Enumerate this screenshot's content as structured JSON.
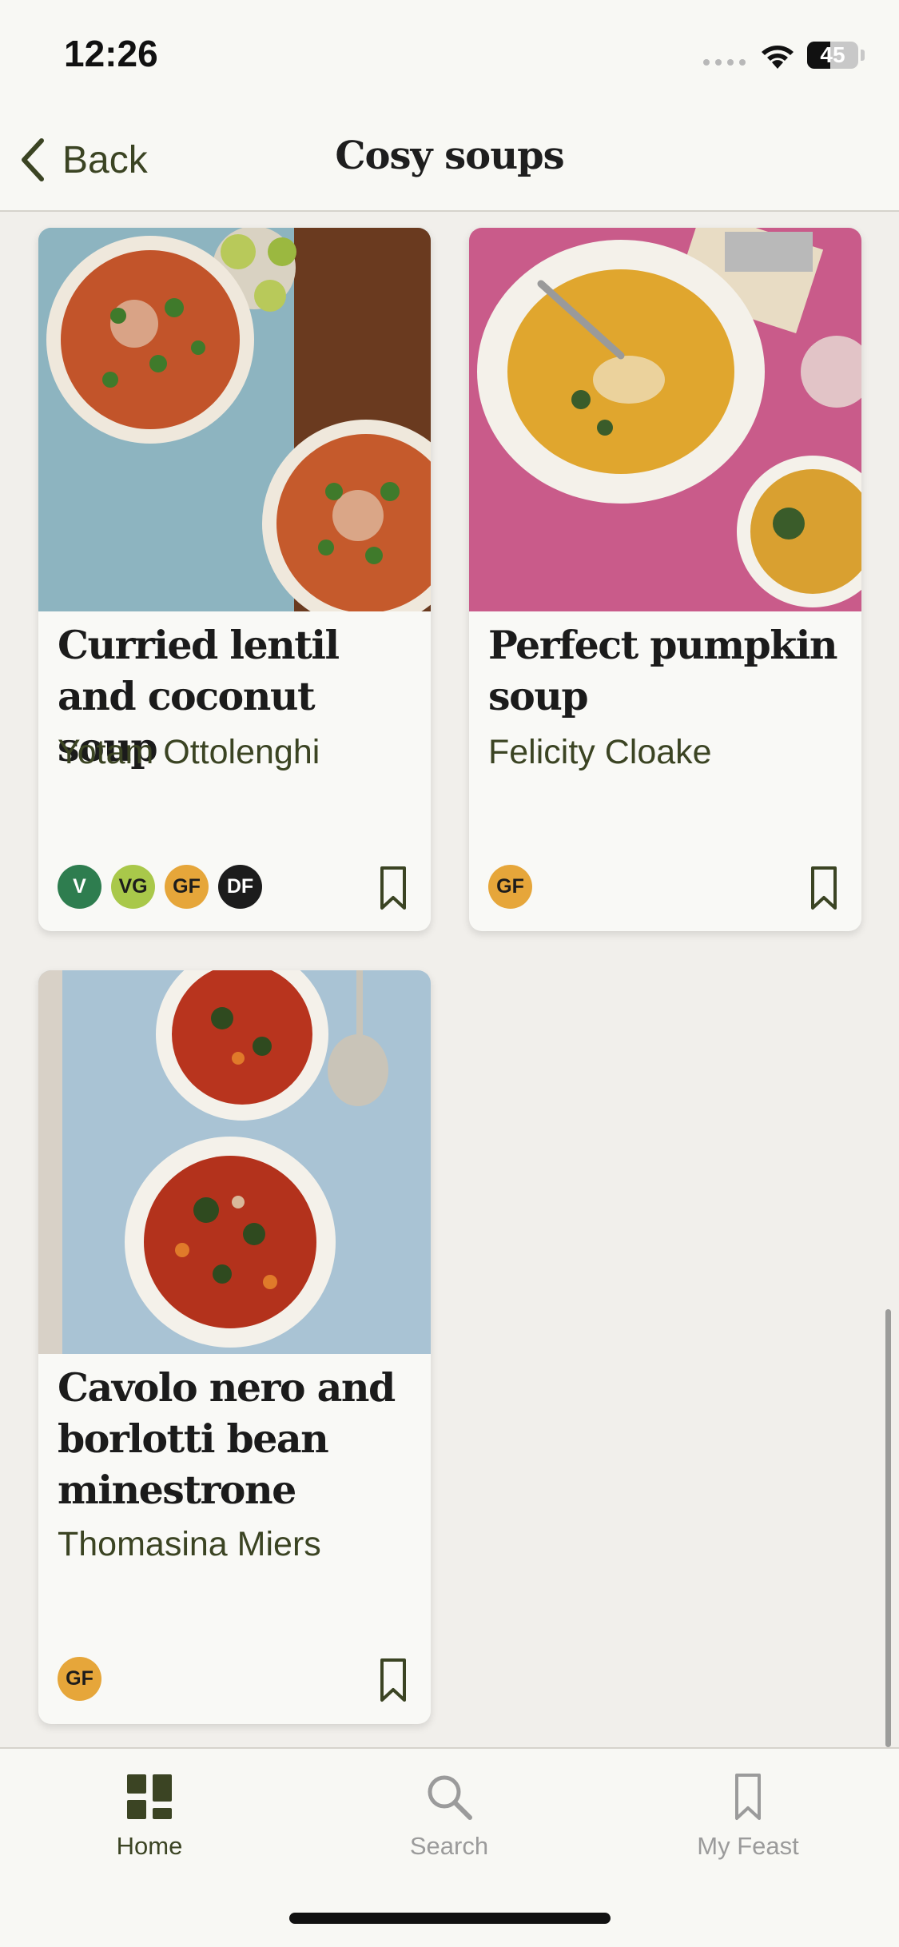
{
  "status_bar": {
    "time": "12:26",
    "battery_level": "45"
  },
  "header": {
    "back_label": "Back",
    "title": "Cosy soups"
  },
  "recipes": [
    {
      "title": "Curried lentil and coconut soup",
      "author": "Yotam Ottolenghi",
      "badges": [
        "V",
        "VG",
        "GF",
        "DF"
      ]
    },
    {
      "title": "Perfect pumpkin soup",
      "author": "Felicity Cloake",
      "badges": [
        "GF"
      ]
    },
    {
      "title": "Cavolo nero and borlotti bean minestrone",
      "author": "Thomasina Miers",
      "badges": [
        "GF"
      ]
    }
  ],
  "badge_colors": {
    "V": "#2e7d4f",
    "VG": "#a9c84a",
    "GF": "#e6a63a",
    "DF": "#1c1c1c"
  },
  "tab_bar": {
    "tabs": [
      {
        "label": "Home",
        "icon": "home-grid-icon",
        "active": true
      },
      {
        "label": "Search",
        "icon": "search-icon",
        "active": false
      },
      {
        "label": "My Feast",
        "icon": "bookmark-icon",
        "active": false
      }
    ]
  },
  "colors": {
    "accent": "#3b4423",
    "inactive": "#9b9b9b"
  }
}
